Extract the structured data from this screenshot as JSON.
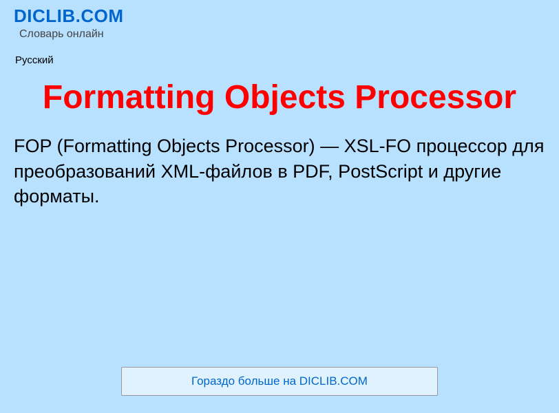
{
  "header": {
    "site_title": "DICLIB.COM",
    "site_subtitle": "Словарь онлайн",
    "language": "Русский"
  },
  "main": {
    "title": "Formatting Objects Processor",
    "description": "FOP (Formatting Objects Processor) — XSL-FO процессор для преобразований XML-файлов в PDF, PostScript и другие форматы."
  },
  "footer": {
    "button_label": "Гораздо больше на DICLIB.COM"
  }
}
